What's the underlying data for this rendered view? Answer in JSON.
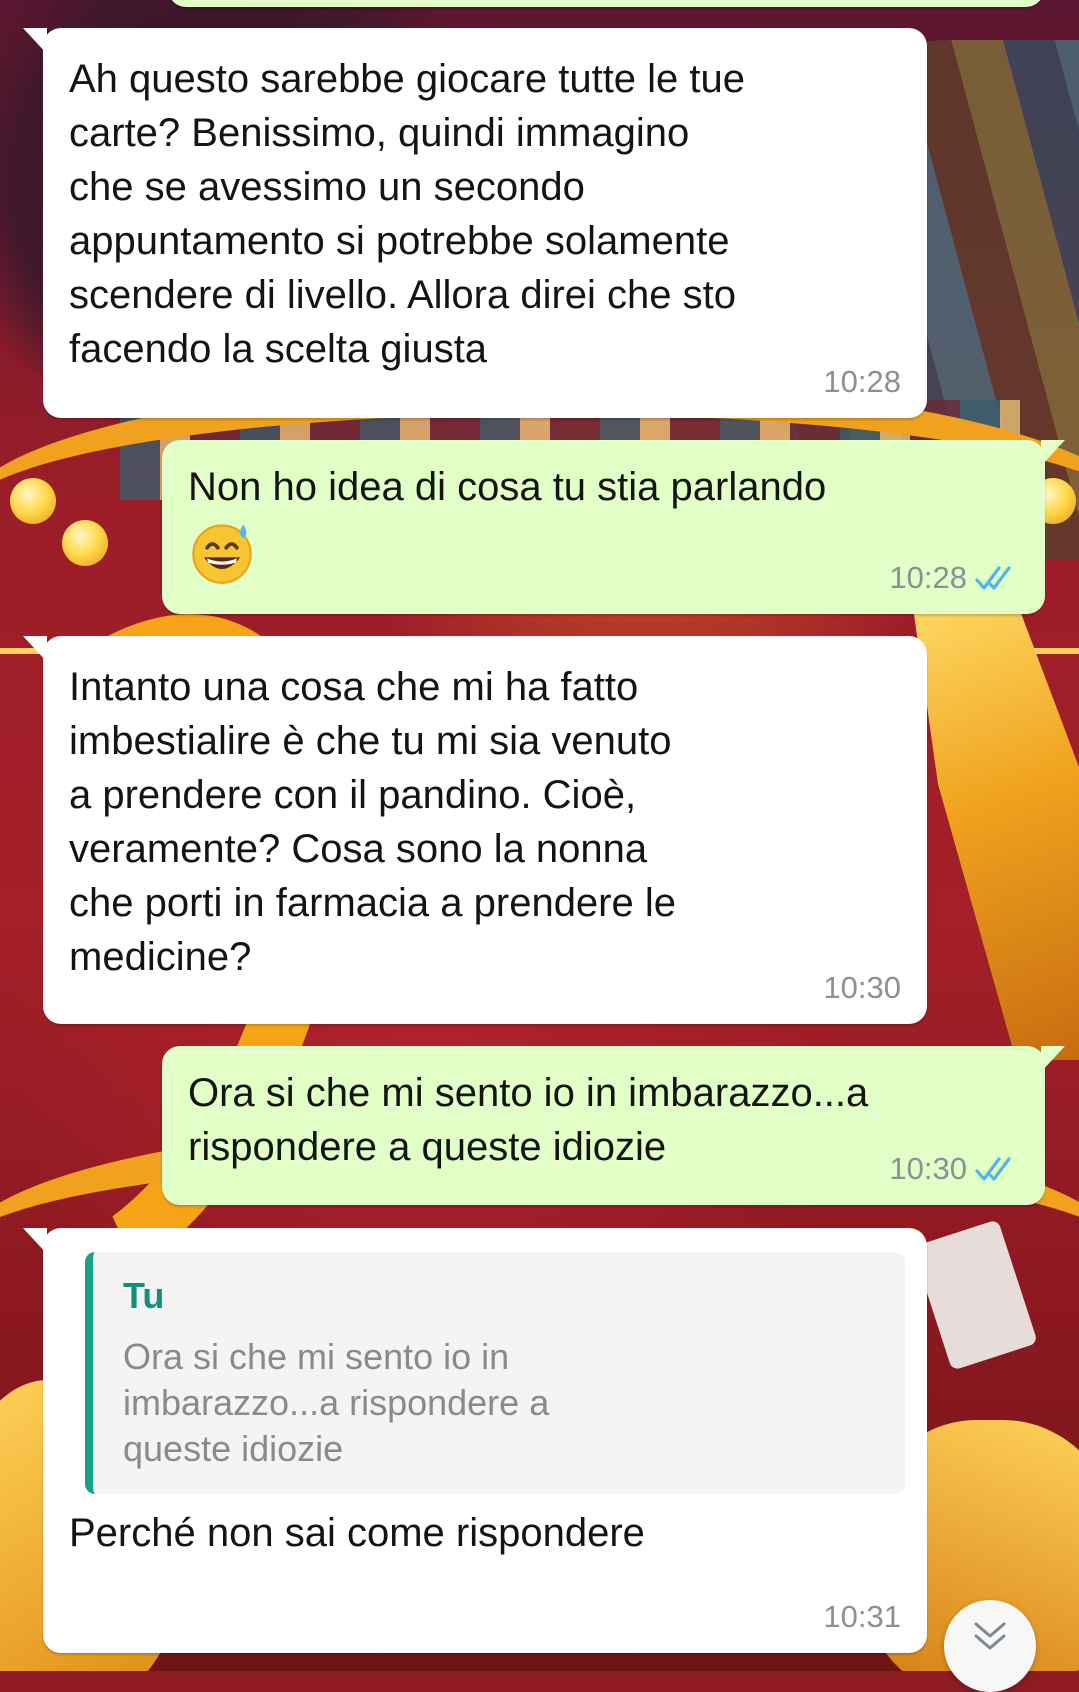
{
  "conversation": {
    "messages": [
      {
        "direction": "incoming",
        "text": "Ah questo sarebbe giocare tutte le tue\ncarte? Benissimo, quindi immagino\nche se avessimo un secondo\nappuntamento si potrebbe solamente\nscendere di livello. Allora direi che sto\nfacendo la scelta giusta",
        "time": "10:28"
      },
      {
        "direction": "outgoing",
        "text": "Non ho idea di cosa tu stia parlando",
        "emoji": "grinning-face-with-sweat",
        "time": "10:28",
        "status": "read"
      },
      {
        "direction": "incoming",
        "text": "Intanto una cosa che mi ha fatto\nimbestialire è che tu mi sia venuto\na prendere con il pandino. Cioè,\nveramente? Cosa sono la nonna\nche porti in farmacia a prendere le\nmedicine?",
        "time": "10:30"
      },
      {
        "direction": "outgoing",
        "text": "Ora si che mi sento io in imbarazzo...a\nrispondere a queste idiozie",
        "time": "10:30",
        "status": "read"
      },
      {
        "direction": "incoming",
        "quote": {
          "author": "Tu",
          "text": "Ora si che mi sento io in\nimbarazzo...a rispondere a\nqueste idiozie"
        },
        "text": "Perché non sai come rispondere",
        "time": "10:31"
      }
    ]
  },
  "theme": {
    "incoming_bubble": "#ffffff",
    "outgoing_bubble": "#e2ffc8",
    "read_ticks": "#4fb6ec",
    "quote_accent": "#1aa18b",
    "timestamp": "#8b9096"
  },
  "scroll_button": {
    "icon": "double-chevron-down-icon"
  }
}
